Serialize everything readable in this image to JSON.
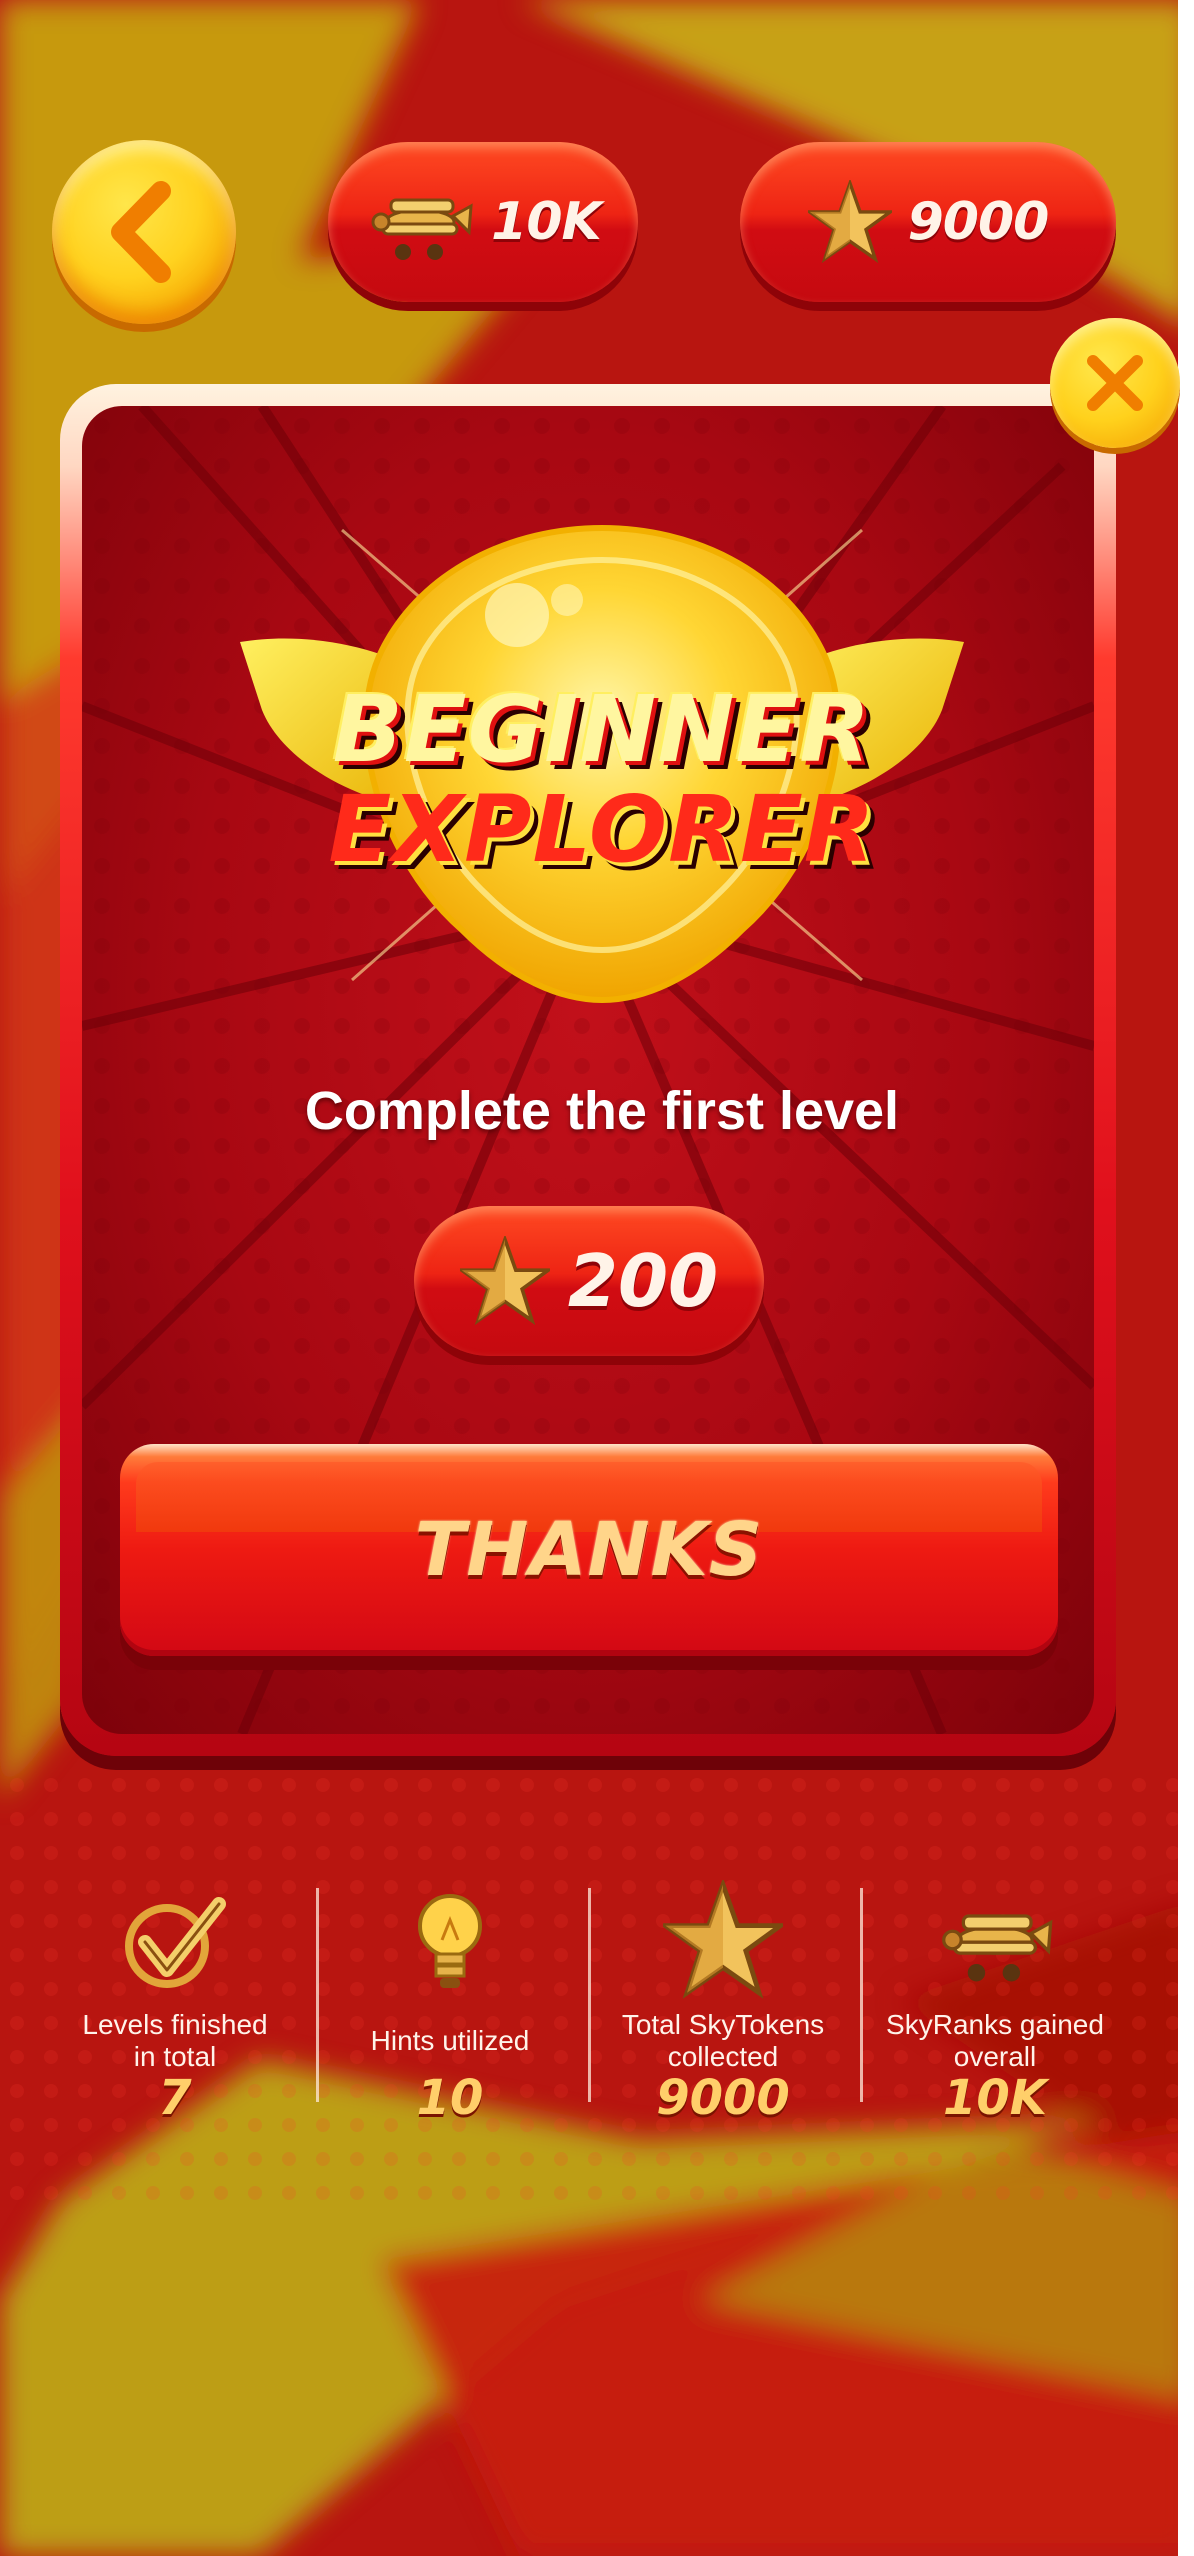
{
  "header": {
    "planes_value": "10K",
    "stars_value": "9000"
  },
  "achievement": {
    "badge_line1": "BEGINNER",
    "badge_line2": "EXPLORER",
    "description": "Complete the first level",
    "reward_value": "200",
    "thanks_label": "THANKS"
  },
  "stats": [
    {
      "label_line1": "Levels finished",
      "label_line2": "in total",
      "value": "7",
      "icon": "checkmark-icon"
    },
    {
      "label_line1": "Hints utilized",
      "label_line2": "",
      "value": "10",
      "icon": "lightbulb-icon"
    },
    {
      "label_line1": "Total SkyTokens",
      "label_line2": "collected",
      "value": "9000",
      "icon": "star-icon"
    },
    {
      "label_line1": "SkyRanks gained",
      "label_line2": "overall",
      "value": "10K",
      "icon": "plane-icon"
    }
  ],
  "colors": {
    "background_red": "#c11a10",
    "accent_yellow": "#ffd21f",
    "pill_red": "#e01414",
    "gold": "#ffcf6a"
  }
}
